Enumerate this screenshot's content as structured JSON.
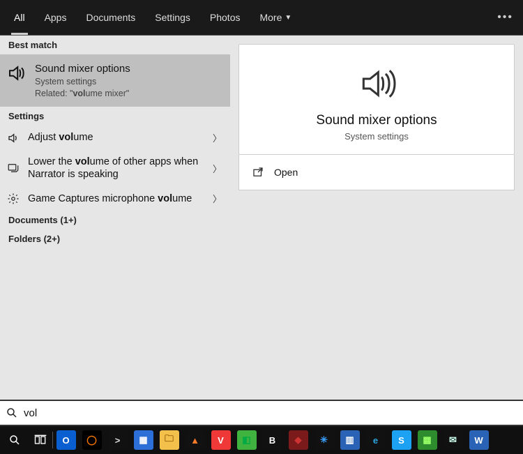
{
  "tabs": {
    "items": [
      "All",
      "Apps",
      "Documents",
      "Settings",
      "Photos",
      "More"
    ],
    "more_has_chevron": true
  },
  "left": {
    "best_match_header": "Best match",
    "best": {
      "title": "Sound mixer options",
      "subtitle": "System settings",
      "related_prefix": "Related: \"",
      "related_bold": "vol",
      "related_rest": "ume mixer\""
    },
    "settings_header": "Settings",
    "settings_items": [
      {
        "pre": "Adjust ",
        "bold": "vol",
        "post": "ume",
        "icon": "speaker"
      },
      {
        "pre": "Lower the ",
        "bold": "vol",
        "post": "ume of other apps when Narrator is speaking",
        "icon": "narrator"
      },
      {
        "pre": "Game Captures microphone ",
        "bold": "vol",
        "post": "ume",
        "icon": "gear"
      }
    ],
    "documents_header": "Documents (1+)",
    "folders_header": "Folders (2+)"
  },
  "preview": {
    "title": "Sound mixer options",
    "subtitle": "System settings",
    "open_label": "Open"
  },
  "search": {
    "value": "vol"
  },
  "taskbar": {
    "apps": [
      {
        "name": "outlook",
        "bg": "#0a5fd0",
        "fg": "#fff",
        "glyph": "O"
      },
      {
        "name": "everything",
        "bg": "#000",
        "fg": "#ff7a00",
        "glyph": "◯"
      },
      {
        "name": "terminal",
        "bg": "#111",
        "fg": "#ddd",
        "glyph": ">"
      },
      {
        "name": "calculator",
        "bg": "#2c6fd6",
        "fg": "#fff",
        "glyph": "▦"
      },
      {
        "name": "explorer",
        "bg": "#f3c04b",
        "fg": "#8a5a00",
        "glyph": "🗀"
      },
      {
        "name": "vlc",
        "bg": "#111",
        "fg": "#ff7a29",
        "glyph": "▲"
      },
      {
        "name": "vivaldi",
        "bg": "#ef3939",
        "fg": "#fff",
        "glyph": "V"
      },
      {
        "name": "greenshot",
        "bg": "#3fb23f",
        "fg": "#0a4",
        "glyph": "◧"
      },
      {
        "name": "bold-app",
        "bg": "#111",
        "fg": "#fff",
        "glyph": "B"
      },
      {
        "name": "red-app",
        "bg": "#7a1a1a",
        "fg": "#c33",
        "glyph": "◆"
      },
      {
        "name": "blue-app",
        "bg": "#111",
        "fg": "#3aa0ff",
        "glyph": "✳"
      },
      {
        "name": "panels",
        "bg": "#2a63b5",
        "fg": "#fff",
        "glyph": "▥"
      },
      {
        "name": "edge",
        "bg": "#111",
        "fg": "#2aa7e0",
        "glyph": "e"
      },
      {
        "name": "skype",
        "bg": "#1da1f2",
        "fg": "#fff",
        "glyph": "S"
      },
      {
        "name": "green2",
        "bg": "#2e8b2e",
        "fg": "#9f6",
        "glyph": "▩"
      },
      {
        "name": "mail",
        "bg": "#111",
        "fg": "#cfe",
        "glyph": "✉"
      },
      {
        "name": "word",
        "bg": "#2a63b5",
        "fg": "#fff",
        "glyph": "W"
      }
    ]
  }
}
